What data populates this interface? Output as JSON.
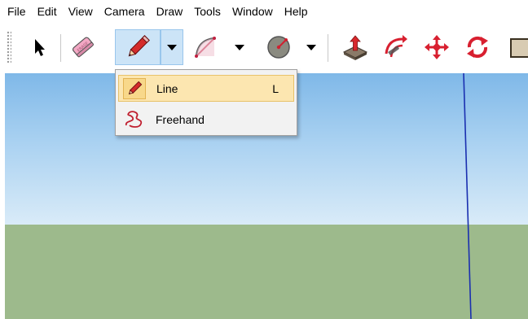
{
  "menubar": {
    "items": [
      "File",
      "Edit",
      "View",
      "Camera",
      "Draw",
      "Tools",
      "Window",
      "Help"
    ]
  },
  "toolbar": {
    "tools": [
      {
        "name": "select",
        "icon": "arrow-cursor-icon"
      },
      {
        "name": "eraser",
        "icon": "eraser-icon"
      },
      {
        "name": "pencil",
        "icon": "pencil-icon",
        "active": true
      },
      {
        "name": "arc",
        "icon": "arc-icon"
      },
      {
        "name": "circle",
        "icon": "circle-icon"
      },
      {
        "name": "push-pull",
        "icon": "push-pull-icon"
      },
      {
        "name": "follow-me",
        "icon": "follow-me-icon"
      },
      {
        "name": "move",
        "icon": "move-icon"
      },
      {
        "name": "rotate",
        "icon": "rotate-icon"
      }
    ]
  },
  "draw_menu": {
    "items": [
      {
        "label": "Line",
        "shortcut": "L",
        "icon": "pencil-icon",
        "highlighted": true
      },
      {
        "label": "Freehand",
        "shortcut": "",
        "icon": "freehand-icon",
        "highlighted": false
      }
    ]
  },
  "colors": {
    "sky_top": "#7fb8e8",
    "sky_bottom": "#d9ebf8",
    "ground": "#9dba8c",
    "axis_blue": "#1a2fb0",
    "menu_highlight": "#fce6b0",
    "toolbar_active": "#cce4f7"
  }
}
